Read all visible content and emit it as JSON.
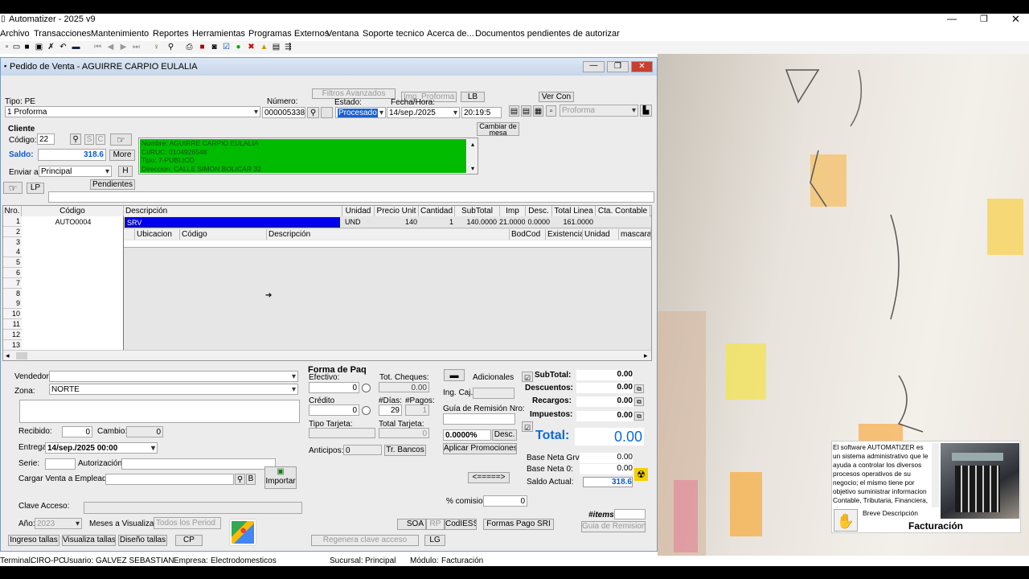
{
  "app": {
    "title": "Automatizer - 2025 v9"
  },
  "menu": [
    "Archivo",
    "Transacciones",
    "Mantenimiento",
    "Reportes",
    "Herramientas",
    "Programas Externos",
    "Ventana",
    "Soporte tecnico",
    "Acerca de...",
    "Documentos pendientes de autorizar"
  ],
  "doc": {
    "title": "Pedido de Venta -  AGUIRRE CARPIO EULALIA",
    "tipo_label": "Tipo: PE",
    "tipo_value": "1 Proforma",
    "numero_label": "Número:",
    "numero": "000005338",
    "filtros": "Filtros Avanzados",
    "imp_proforma": "Imp. Proforma",
    "lb": "LB",
    "ver_con": "Ver Con",
    "estado_label": "Estado:",
    "estado": "Procesado",
    "fecha_label": "Fecha/Hora:",
    "fecha": "14/sep./2025",
    "hora": "20:19:5",
    "proforma": "Proforma",
    "cambiar_mesa": "Cambiar de mesa"
  },
  "cliente": {
    "heading": "Cliente",
    "codigo_label": "Código:",
    "codigo": "22",
    "s": "S",
    "c": "C",
    "saldo_label": "Saldo:",
    "saldo": "318.6",
    "more": "More",
    "enviar_label": "Enviar a:",
    "enviar": "Principal",
    "h": "H",
    "lp": "LP",
    "pendientes": "Pendientes",
    "info": [
      "Nombre: AGUIRRE CARPIO EULALIA",
      "CI/RUC: 0104926548",
      "Tipo: 7-PUBLICO",
      "Direccion: CALLE SIMON BOLICAR 32"
    ]
  },
  "grid": {
    "headers": [
      "Nro.",
      "Código",
      "Descripción",
      "Unidad",
      "Precio Unit",
      "Cantidad",
      "SubTotal",
      "Imp",
      "Desc.",
      "Total Linea",
      "Cta. Contable"
    ],
    "row": {
      "nro": "1",
      "codigo": "AUTO0004",
      "descripcion": "SRV",
      "unidad": "UND",
      "precio": "140",
      "cantidad": "1",
      "subtotal": "140.0000",
      "imp": "21.0000",
      "desc": "0.0000",
      "total": "161.0000"
    },
    "rows": [
      "1",
      "2",
      "3",
      "4",
      "5",
      "6",
      "7",
      "8",
      "9",
      "10",
      "11",
      "12",
      "13"
    ],
    "sub_headers": [
      "Ubicacion",
      "Código",
      "Descripción",
      "BodCod",
      "Existencia",
      "Unidad",
      "mascara"
    ]
  },
  "bottom": {
    "vendedor": "Vendedor",
    "zona": "Zona:",
    "zona_val": "NORTE",
    "recibido": "Recibido:",
    "recibido_val": "0",
    "cambio": "Cambio:",
    "cambio_val": "0",
    "entrega": "Entrega:",
    "entrega_val": "14/sep./2025 00:00",
    "serie": "Serie:",
    "autorizacion": "Autorización:",
    "cargar": "Cargar Venta a Empleado:",
    "b": "B",
    "importar": "Importar",
    "clave": "Clave Acceso:",
    "anio": "Año:",
    "anio_val": "2023",
    "meses": "Meses a Visualizar:",
    "meses_val": "Todos los Period",
    "ingreso": "Ingreso tallas",
    "visualiza": "Visualiza tallas",
    "diseno": "Diseño tallas",
    "cp": "CP"
  },
  "pago": {
    "forma": "Forma de Paq",
    "efectivo": "Efectivo:",
    "efectivo_val": "0",
    "credito": "Crédito",
    "credito_val": "0",
    "tipo_tarjeta": "Tipo Tarjeta:",
    "anticipos": "Anticipos:",
    "anticipos_val": "0",
    "tot_cheques": "Tot. Cheques:",
    "tot_cheques_val": "0.00",
    "dias": "#Días:",
    "dias_val": "29",
    "pagos": "#Pagos:",
    "pagos_val": "1",
    "total_tarjeta": "Total Tarjeta:",
    "total_tarjeta_val": "0",
    "tr_bancos": "Tr. Bancos",
    "adicionales": "Adicionales",
    "ing_caj": "Ing. Caj.",
    "guia_nro": "Guía de Remisión Nro:",
    "porc": "0.0000%",
    "desc_btn": "Desc.",
    "aplicar": "Aplicar Promociones",
    "arrow": "<=====>",
    "comision": "% comision",
    "comision_val": "0",
    "soa": "SOA",
    "rp": "RP",
    "codiess": "CodIESS",
    "formas": "Formas Pago SRI",
    "regenera": "Regenera clave acceso",
    "lg": "LG"
  },
  "totales": {
    "subtotal_l": "SubTotal:",
    "subtotal": "0.00",
    "descuentos_l": "Descuentos:",
    "descuentos": "0.00",
    "recargos_l": "Recargos:",
    "recargos": "0.00",
    "impuestos_l": "Impuestos:",
    "impuestos": "0.00",
    "total_l": "Total:",
    "total": "0.00",
    "bng_l": "Base Neta Grv:",
    "bng": "0.00",
    "bn0_l": "Base Neta 0:",
    "bn0": "0.00",
    "saldo_l": "Saldo Actual:",
    "saldo": "318.6",
    "items_l": "#items:",
    "guia_btn": "Guia de Remision"
  },
  "status": {
    "terminal_l": "Terminal:",
    "terminal": "CIRO-PC",
    "usuario_l": "Usuario:",
    "usuario": "GALVEZ SEBASTIAN",
    "empresa_l": "Empresa:",
    "empresa": "Electrodomesticos",
    "sucursal_l": "Sucursal:",
    "sucursal": "Principal",
    "modulo_l": "Módulo:",
    "modulo": "Facturación"
  },
  "promo": {
    "text": "El software AUTOMATIZER es un sistema administrativo que le ayuda a controlar los diversos procesos operativos de su negocio; el mismo tiene por objetivo suministrar informacion Contable, Tributaria, Financiera, etc que",
    "breve": "Breve Descripción",
    "title": "Facturación"
  },
  "colors": {
    "client_box": "#00bb00",
    "selected": "#0000ee",
    "total": "#0a6adf"
  }
}
